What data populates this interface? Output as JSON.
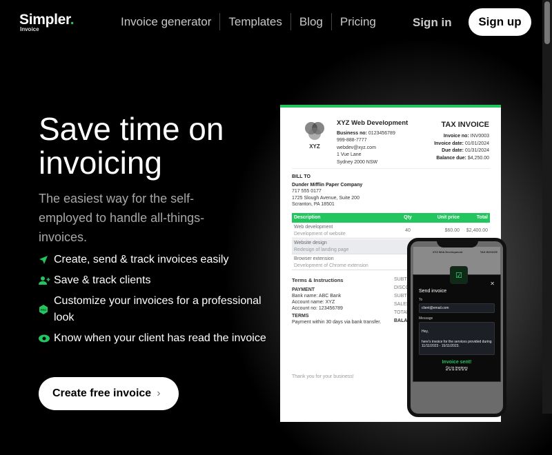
{
  "nav": {
    "logo": "Simpler",
    "logo_dot": ".",
    "logo_sub": "Invoice",
    "links": [
      "Invoice generator",
      "Templates",
      "Blog",
      "Pricing"
    ],
    "sign_in": "Sign in",
    "sign_up": "Sign up"
  },
  "hero": {
    "title": "Save time on invoicing",
    "subtitle": "The easiest way for the self-employed to handle all-things-invoices.",
    "features": [
      {
        "icon": "send-icon",
        "text": "Create, send & track invoices easily"
      },
      {
        "icon": "user-plus-icon",
        "text": "Save & track clients"
      },
      {
        "icon": "pro-badge-icon",
        "text": "Customize your invoices for a professional look"
      },
      {
        "icon": "eye-icon",
        "text": "Know when your client has read the invoice"
      }
    ],
    "cta": "Create free invoice",
    "cta_chevron": "›"
  },
  "invoice": {
    "logo_text": "XYZ",
    "company": "XYZ Web Development",
    "business_no_label": "Business no:",
    "business_no": "0123456789",
    "phone": "999-888-7777",
    "email": "webdev@xyz.com",
    "address1": "1 Vue Lane",
    "address2": "Sydney 2000 NSW",
    "title": "TAX INVOICE",
    "meta": [
      {
        "label": "Invoice no:",
        "value": "INV0003"
      },
      {
        "label": "Invoice date:",
        "value": "01/01/2024"
      },
      {
        "label": "Due date:",
        "value": "01/31/2024"
      },
      {
        "label": "Balance due:",
        "value": "$4,250.00"
      }
    ],
    "bill_to_label": "BILL TO",
    "client": "Dunder Mifflin Paper Company",
    "client_phone": "717 555 0177",
    "client_address1": "1725 Slough Avenue, Suite 200",
    "client_address2": "Scranton, PA 18501",
    "columns": [
      "Description",
      "Qty",
      "Unit price",
      "Total"
    ],
    "items": [
      {
        "name": "Web development",
        "desc": "Development of website",
        "qty": "40",
        "price": "$60.00",
        "total": "$2,400.00"
      },
      {
        "name": "Website design",
        "desc": "Redesign of landing page",
        "qty": "",
        "price": "",
        "total": ""
      },
      {
        "name": "Browser extension",
        "desc": "Development of Chrome extension",
        "qty": "",
        "price": "",
        "total": ""
      }
    ],
    "terms_title": "Terms & Instructions",
    "payment_label": "PAYMENT",
    "bank": "Bank name: ABC Bank",
    "account_name": "Account name: XYZ",
    "account_no": "Account no: 123456789",
    "terms_label": "TERMS",
    "terms": "Payment within 30 days via bank transfer.",
    "totals": [
      "SUBTOTAL",
      "DISCOUNT",
      "SUBTOTAL",
      "SALES TAX",
      "TOTAL",
      "BALANCE"
    ],
    "thanks": "Thank you for your business!"
  },
  "phone": {
    "mini_company": "XYZ Web Development",
    "mini_title": "TAX INVOICE",
    "modal_title": "Send invoice",
    "to_label": "To",
    "to_value": "client@email.com",
    "message_label": "Message",
    "message_line1": "Hey,",
    "message_line2": "here's invoice for the services provided during 11/11/2023 - 15/11/2023.",
    "sent": "Invoice sent!",
    "go_link": "Go to invoices",
    "close": "✕",
    "check": "☑"
  },
  "colors": {
    "accent": "#22c55e",
    "background": "#000000"
  }
}
